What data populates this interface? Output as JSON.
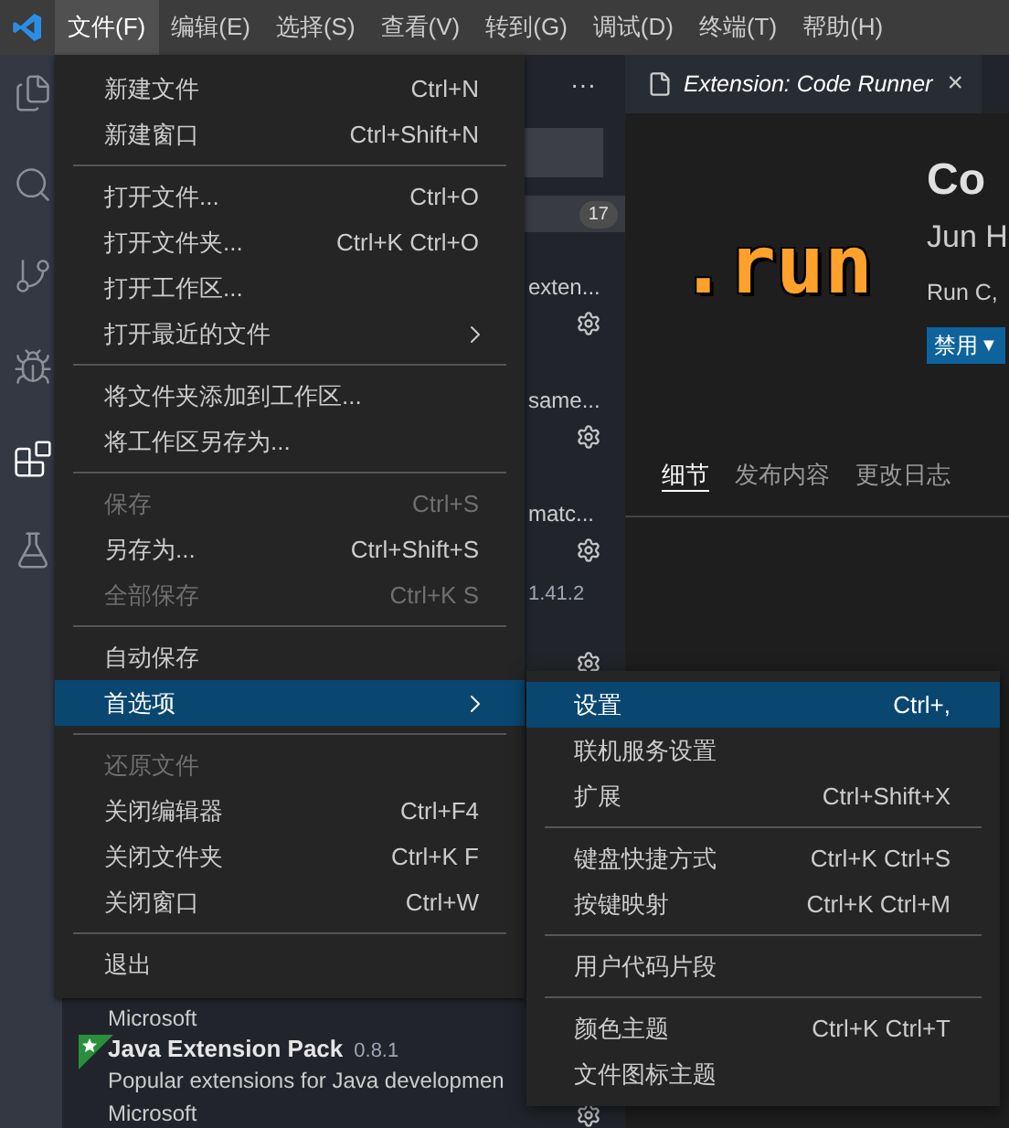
{
  "menu_bar": {
    "items": [
      {
        "label": "文件(F)",
        "selected": true
      },
      {
        "label": "编辑(E)",
        "selected": false
      },
      {
        "label": "选择(S)",
        "selected": false
      },
      {
        "label": "查看(V)",
        "selected": false
      },
      {
        "label": "转到(G)",
        "selected": false
      },
      {
        "label": "调试(D)",
        "selected": false
      },
      {
        "label": "终端(T)",
        "selected": false
      },
      {
        "label": "帮助(H)",
        "selected": false
      }
    ]
  },
  "activity_bar": {
    "items": [
      {
        "selected": false
      },
      {
        "selected": false
      },
      {
        "selected": false
      },
      {
        "selected": false
      },
      {
        "selected": true
      },
      {
        "selected": false
      }
    ]
  },
  "sidebar": {
    "more": "···",
    "badge": "17",
    "rows": [
      {
        "kind": "clipped",
        "description": "exten..."
      },
      {
        "kind": "clipped",
        "description": "same..."
      },
      {
        "kind": "clipped",
        "description": "matc..."
      },
      {
        "kind": "clipped",
        "version": "1.41.2"
      },
      {
        "kind": "full",
        "publisher": "Microsoft",
        "starred": false
      },
      {
        "kind": "full",
        "name": "Java Extension Pack",
        "version": "0.8.1",
        "description": "Popular extensions for Java developmen",
        "publisher": "Microsoft",
        "starred": true
      }
    ]
  },
  "editor": {
    "tab": {
      "title": "Extension: Code Runner",
      "close": "×"
    },
    "extension": {
      "logo": ".run",
      "name": "Co",
      "author": "Jun H",
      "description": "Run C,",
      "button": {
        "label": "禁用",
        "caret": "▼"
      },
      "tabs": [
        {
          "label": "细节",
          "selected": true
        },
        {
          "label": "发布内容",
          "selected": false
        },
        {
          "label": "更改日志",
          "selected": false
        }
      ]
    }
  },
  "file_menu": {
    "groups": [
      [
        {
          "label": "新建文件",
          "shortcut": "Ctrl+N",
          "disabled": false,
          "selected": false
        },
        {
          "label": "新建窗口",
          "shortcut": "Ctrl+Shift+N",
          "disabled": false,
          "selected": false
        }
      ],
      [
        {
          "label": "打开文件...",
          "shortcut": "Ctrl+O",
          "disabled": false,
          "selected": false
        },
        {
          "label": "打开文件夹...",
          "shortcut": "Ctrl+K Ctrl+O",
          "disabled": false,
          "selected": false
        },
        {
          "label": "打开工作区...",
          "disabled": false,
          "selected": false
        },
        {
          "label": "打开最近的文件",
          "submenu": true,
          "disabled": false,
          "selected": false
        }
      ],
      [
        {
          "label": "将文件夹添加到工作区...",
          "disabled": false,
          "selected": false
        },
        {
          "label": "将工作区另存为...",
          "disabled": false,
          "selected": false
        }
      ],
      [
        {
          "label": "保存",
          "shortcut": "Ctrl+S",
          "disabled": true,
          "selected": false
        },
        {
          "label": "另存为...",
          "shortcut": "Ctrl+Shift+S",
          "disabled": false,
          "selected": false
        },
        {
          "label": "全部保存",
          "shortcut": "Ctrl+K S",
          "disabled": true,
          "selected": false
        }
      ],
      [
        {
          "label": "自动保存",
          "disabled": false,
          "selected": false
        },
        {
          "label": "首选项",
          "submenu": true,
          "disabled": false,
          "selected": true
        }
      ],
      [
        {
          "label": "还原文件",
          "disabled": true,
          "selected": false
        },
        {
          "label": "关闭编辑器",
          "shortcut": "Ctrl+F4",
          "disabled": false,
          "selected": false
        },
        {
          "label": "关闭文件夹",
          "shortcut": "Ctrl+K F",
          "disabled": false,
          "selected": false
        },
        {
          "label": "关闭窗口",
          "shortcut": "Ctrl+W",
          "disabled": false,
          "selected": false
        }
      ],
      [
        {
          "label": "退出",
          "disabled": false,
          "selected": false
        }
      ]
    ]
  },
  "preferences_menu": {
    "groups": [
      [
        {
          "label": "设置",
          "shortcut": "Ctrl+,",
          "disabled": false,
          "selected": true
        },
        {
          "label": "联机服务设置",
          "disabled": false,
          "selected": false
        },
        {
          "label": "扩展",
          "shortcut": "Ctrl+Shift+X",
          "disabled": false,
          "selected": false
        }
      ],
      [
        {
          "label": "键盘快捷方式",
          "shortcut": "Ctrl+K Ctrl+S",
          "disabled": false,
          "selected": false
        },
        {
          "label": "按键映射",
          "shortcut": "Ctrl+K Ctrl+M",
          "disabled": false,
          "selected": false
        }
      ],
      [
        {
          "label": "用户代码片段",
          "disabled": false,
          "selected": false
        }
      ],
      [
        {
          "label": "颜色主题",
          "shortcut": "Ctrl+K Ctrl+T",
          "disabled": false,
          "selected": false
        },
        {
          "label": "文件图标主题",
          "disabled": false,
          "selected": false
        }
      ]
    ]
  }
}
